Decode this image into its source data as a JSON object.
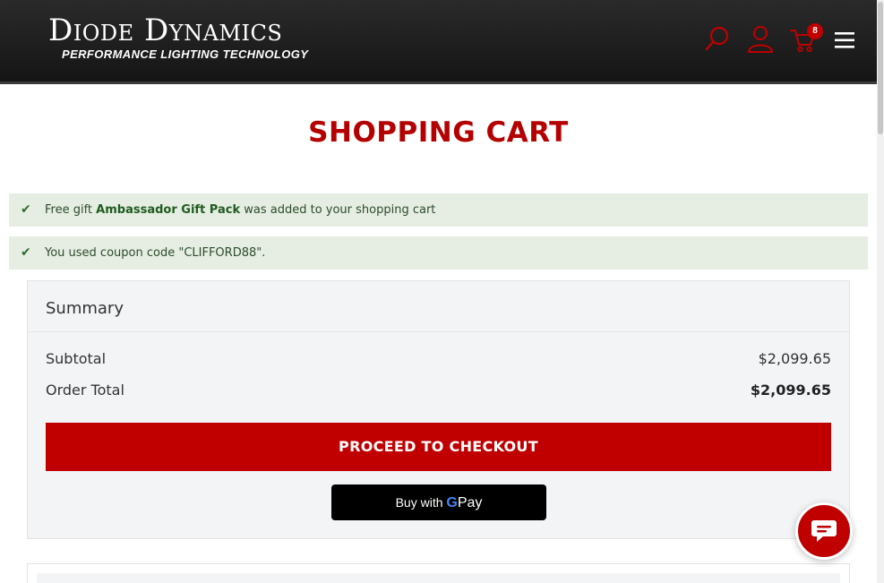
{
  "header": {
    "logo_main": "Diode Dynamics",
    "logo_sub": "PERFORMANCE LIGHTING TECHNOLOGY",
    "cart_count": "8"
  },
  "colors": {
    "brand_red": "#c00000",
    "title_red": "#b40000",
    "header_bg": "#1c1c1c",
    "success_bg": "#e6ede3"
  },
  "icons": [
    "search-icon",
    "user-icon",
    "cart-icon",
    "menu-icon",
    "check-icon",
    "chat-icon"
  ],
  "page": {
    "title": "SHOPPING CART"
  },
  "messages": [
    {
      "prefix": "Free gift ",
      "bold": "Ambassador Gift Pack",
      "suffix": " was added to your shopping cart"
    },
    {
      "text": "You used coupon code \"CLIFFORD88\"."
    }
  ],
  "summary": {
    "title": "Summary",
    "subtotal_label": "Subtotal",
    "subtotal_value": "$2,099.65",
    "total_label": "Order Total",
    "total_value": "$2,099.65",
    "checkout_label": "PROCEED TO CHECKOUT",
    "gpay_prefix": "Buy with",
    "gpay_g": "G",
    "gpay_pay": "Pay"
  }
}
